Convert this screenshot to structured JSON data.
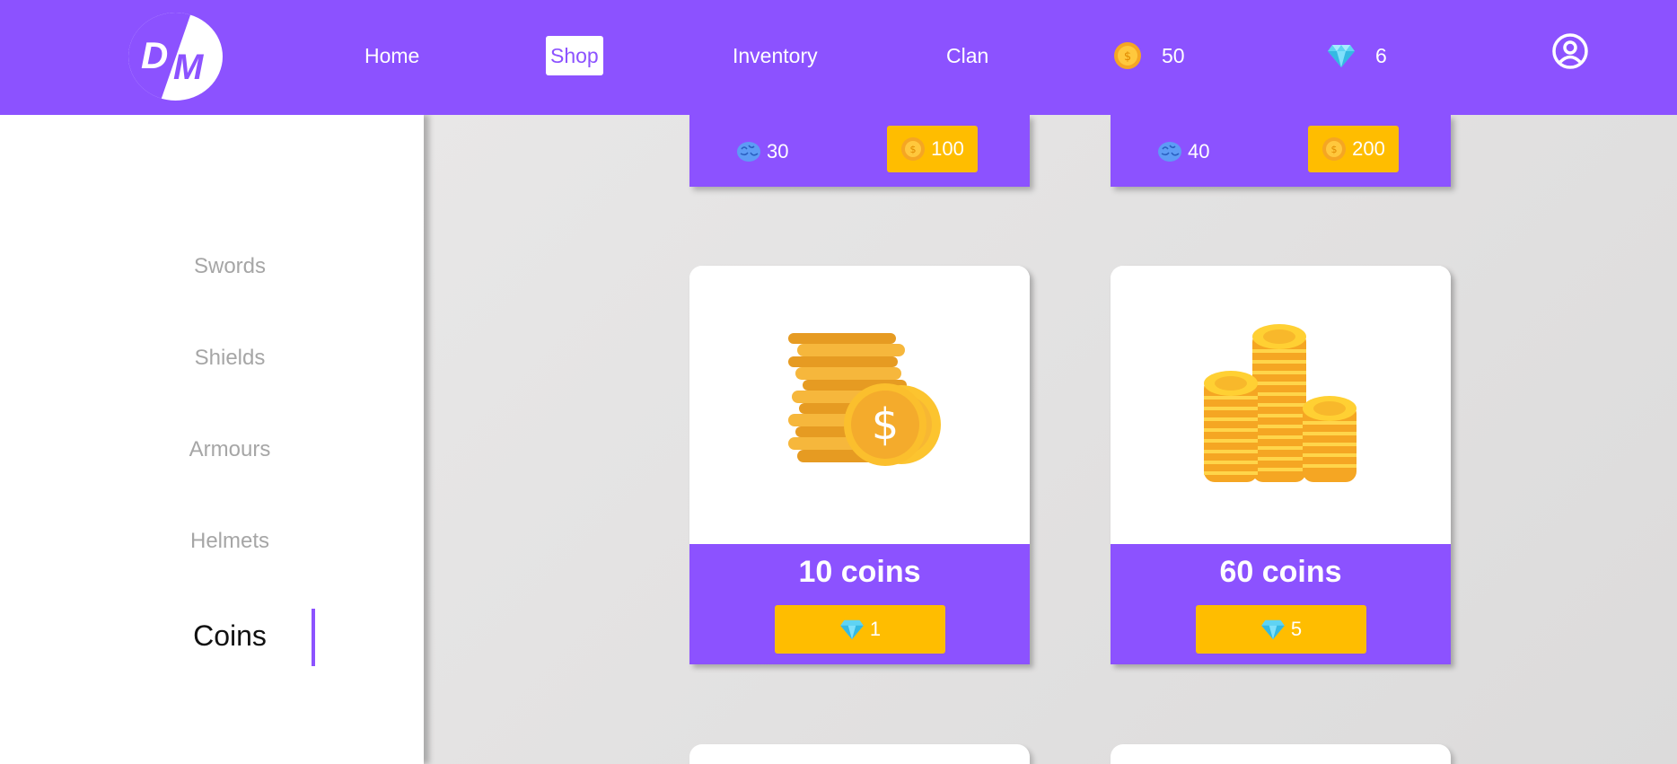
{
  "header": {
    "logo_text": "DM",
    "nav": {
      "home": "Home",
      "shop": "Shop",
      "inventory": "Inventory",
      "clan": "Clan"
    },
    "coins": "50",
    "gems": "6",
    "coin_icon": "coin-icon",
    "gem_icon": "diamond-icon",
    "profile_icon": "user-circle-icon"
  },
  "sidebar": {
    "items": [
      "Swords",
      "Shields",
      "Armours",
      "Helmets",
      "Coins"
    ],
    "active": "Coins"
  },
  "top_cards": [
    {
      "brain": "30",
      "price": "100"
    },
    {
      "brain": "40",
      "price": "200"
    }
  ],
  "cards": [
    {
      "title": "10 coins",
      "price": "1",
      "image": "coin-stack-dollar-icon"
    },
    {
      "title": "60 coins",
      "price": "5",
      "image": "coin-towers-icon"
    }
  ],
  "colors": {
    "accent": "#8c52ff",
    "button": "#ffbd00",
    "sidebar_inactive": "#a6a6a6"
  }
}
